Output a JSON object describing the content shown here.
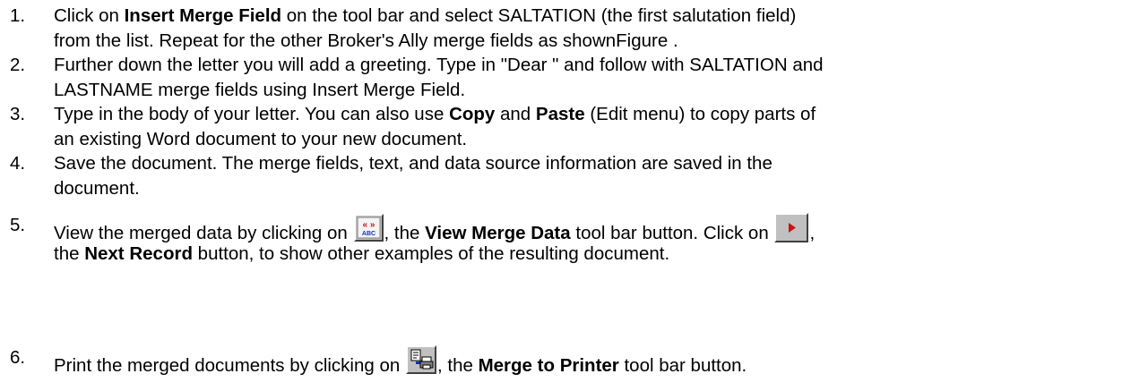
{
  "steps": [
    {
      "num": "1.",
      "line1": {
        "pre": "Click on ",
        "bold": "Insert Merge Field",
        "post": " on the tool bar and select SALTATION (the first salutation field)"
      },
      "line2": "from the list.  Repeat for the other Broker's Ally merge fields as shownFigure ."
    },
    {
      "num": "2.",
      "line1": "Further down the letter you will add a greeting.  Type in \"Dear \" and follow with SALTATION and",
      "line2": "LASTNAME merge fields using Insert Merge Field."
    },
    {
      "num": "3.",
      "line1": {
        "pre": "Type in the body of your letter.  You can also use ",
        "bold1": "Copy",
        "mid": " and ",
        "bold2": "Paste",
        "post": " (Edit menu) to copy parts of"
      },
      "line2": "an existing Word document to your new document."
    },
    {
      "num": "4.",
      "line1": "Save the document.  The merge fields, text, and data source information are saved in the",
      "line2": "document."
    },
    {
      "num": "5.",
      "line1": {
        "pre": "View the merged data by clicking on ",
        "mid1": ", the ",
        "bold1": "View Merge Data",
        "mid2": " tool bar button.  Click on ",
        "post": ","
      },
      "line2": {
        "pre": "the ",
        "bold": "Next Record",
        "post": " button, to show other examples of the resulting document."
      }
    },
    {
      "num": "6.",
      "line1": {
        "pre": "Print the merged documents by clicking on ",
        "mid": ", the ",
        "bold": "Merge to Printer",
        "post": " tool bar button."
      }
    }
  ],
  "icons": {
    "view_merge_data": {
      "icon": "view-merge-data-icon",
      "glyph_top": "« »",
      "glyph_bottom": "ABC",
      "color_top": "#d01010",
      "color_bottom": "#1030c0"
    },
    "next_record": {
      "icon": "next-record-icon",
      "color": "#d01010"
    },
    "merge_to_printer": {
      "icon": "merge-to-printer-icon"
    }
  }
}
